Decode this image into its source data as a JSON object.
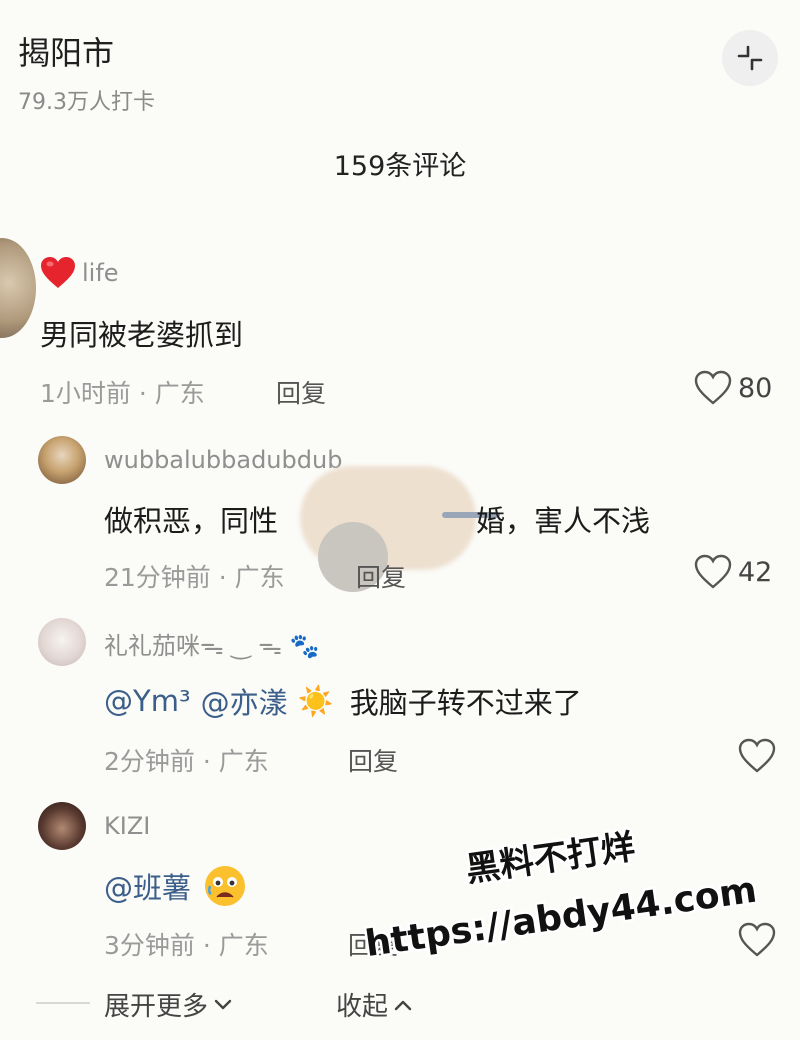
{
  "header": {
    "location": "揭阳市",
    "checkins": "79.3万人打卡",
    "collapse_icon": "collapse-icon"
  },
  "comments_title": "159条评论",
  "main_comment": {
    "username": "life",
    "text": "男同被老婆抓到",
    "meta": "1小时前 · 广东",
    "reply": "回复",
    "likes": "80"
  },
  "replies": [
    {
      "username": "wubbalubbadubdub",
      "text_before": "做积恶，同性",
      "text_after": "婚，害人不浅",
      "meta": "21分钟前 · 广东",
      "reply": "回复",
      "likes": "42"
    },
    {
      "username": "礼礼茄咪ᯓ ‿ ᯓ 🐾",
      "mention1": "@Ym³",
      "mention2": "@亦漾",
      "emoji": "☀️",
      "text": "我脑子转不过来了",
      "meta": "2分钟前 · 广东",
      "reply": "回复"
    },
    {
      "username": "KIZI",
      "mention": "@班薯",
      "emoji": "😰",
      "meta": "3分钟前 · 广东",
      "reply": "回复"
    }
  ],
  "footer": {
    "expand": "展开更多",
    "collapse": "收起"
  },
  "watermark": {
    "line1": "黑料不打烊",
    "line2": "https://abdy44.com"
  }
}
